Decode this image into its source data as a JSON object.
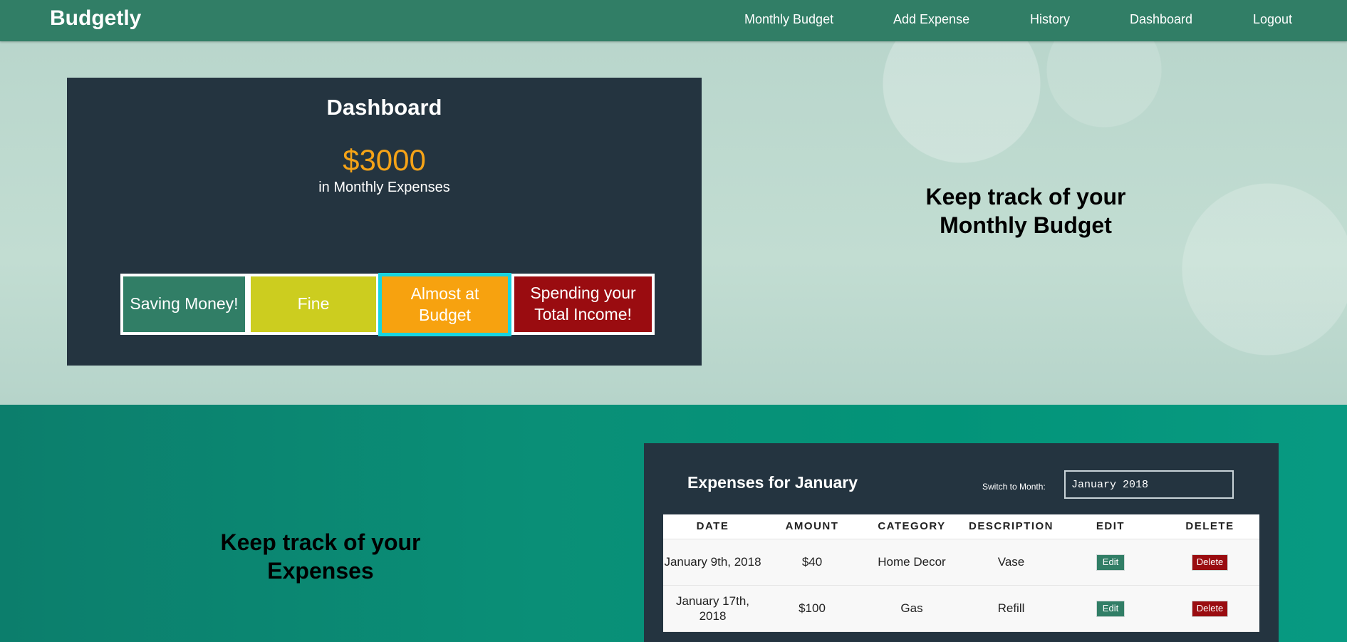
{
  "nav": {
    "brand": "Budgetly",
    "links": [
      "Monthly Budget",
      "Add Expense",
      "History",
      "Dashboard",
      "Logout"
    ]
  },
  "dashboard": {
    "title": "Dashboard",
    "amount": "$3000",
    "subtitle": "in Monthly Expenses",
    "statuses": [
      {
        "label": "Saving Money!",
        "color": "#317e66"
      },
      {
        "label": "Fine",
        "color": "#cccd1f"
      },
      {
        "label": "Almost at Budget",
        "color": "#f7a20f",
        "active": true
      },
      {
        "label": "Spending your Total Income!",
        "color": "#9a0c10"
      }
    ],
    "tagline": "Keep track of your Monthly Budget"
  },
  "expenses": {
    "tagline": "Keep track of your Expenses",
    "title": "Expenses for January",
    "switch_label": "Switch to Month:",
    "month_value": "January 2018",
    "columns": [
      "DATE",
      "AMOUNT",
      "CATEGORY",
      "DESCRIPTION",
      "EDIT",
      "DELETE"
    ],
    "edit_label": "Edit",
    "delete_label": "Delete",
    "rows": [
      {
        "date": "January 9th, 2018",
        "amount": "$40",
        "category": "Home Decor",
        "description": "Vase"
      },
      {
        "date": "January 17th, 2018",
        "amount": "$100",
        "category": "Gas",
        "description": "Refill"
      }
    ]
  },
  "colors": {
    "navbar": "#317e66",
    "card": "#243440",
    "accent_amount": "#f5a317",
    "section2": "#0a8f77"
  }
}
